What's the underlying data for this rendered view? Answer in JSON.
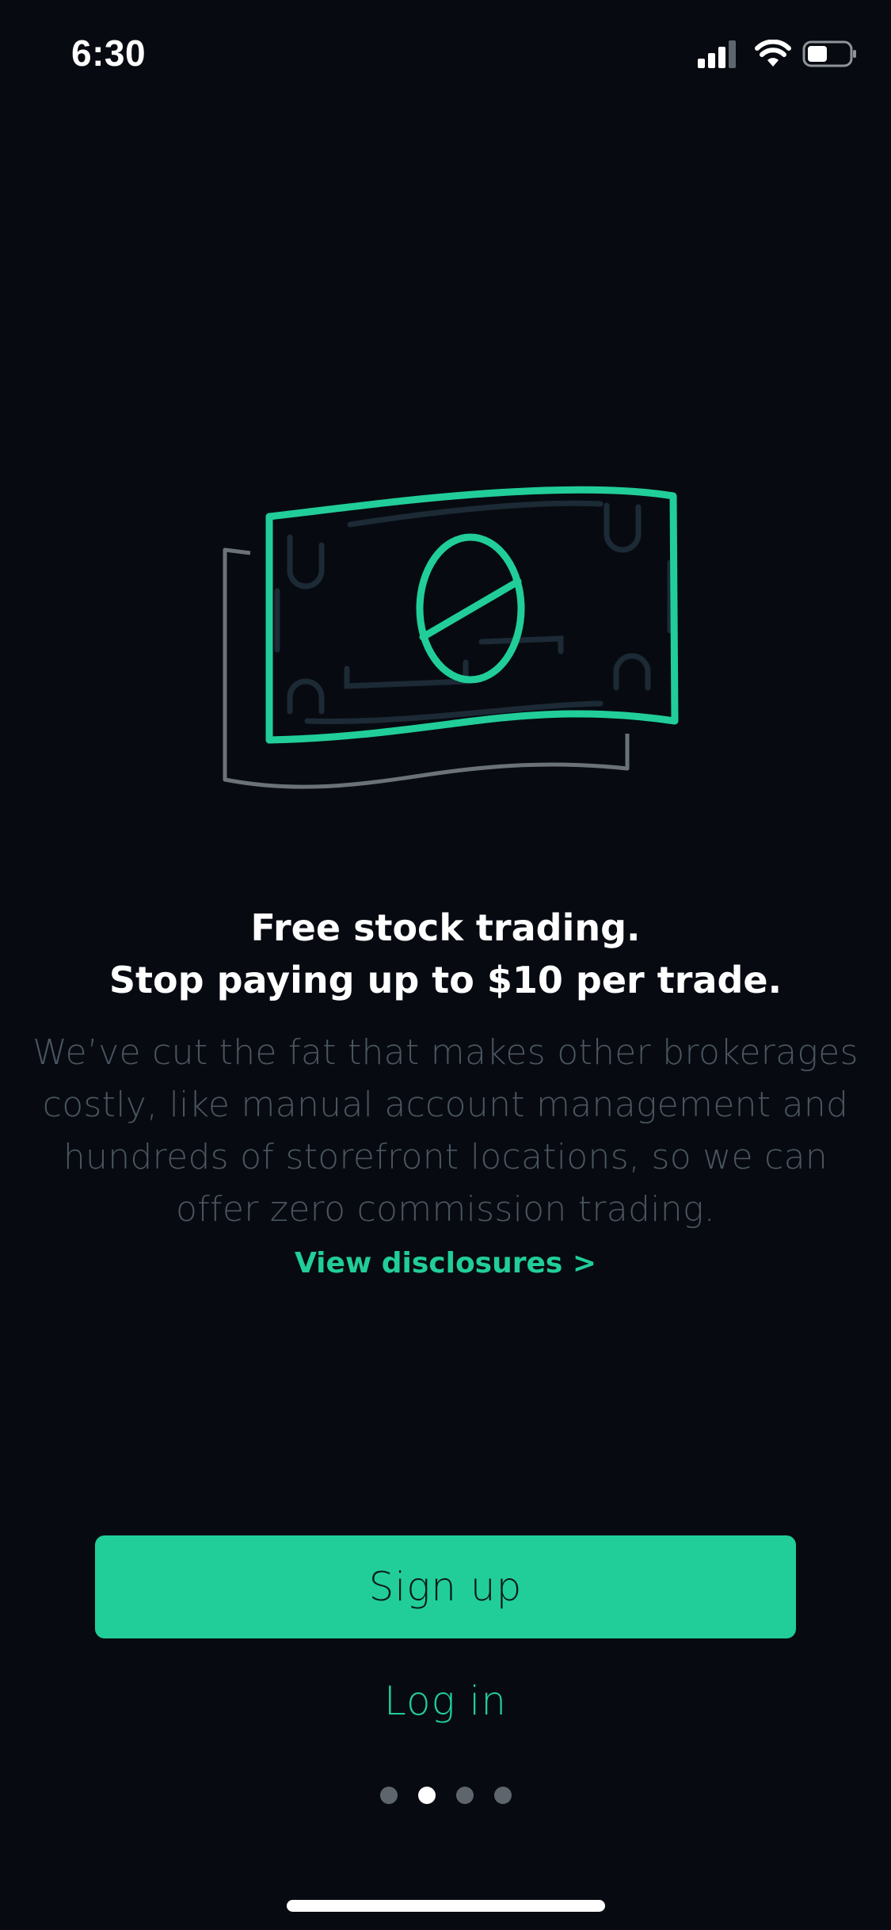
{
  "status_bar": {
    "time": "6:30",
    "icons": [
      "cellular-signal-icon",
      "wifi-icon",
      "battery-icon"
    ]
  },
  "illustration": {
    "icon": "dollar-bill-icon"
  },
  "onboarding": {
    "headline_lines": [
      "Free stock trading.",
      "Stop paying up to $10 per trade."
    ],
    "body_lines": [
      "We’ve cut the fat that makes other brokerages",
      "costly, like manual account management and",
      "hundreds of storefront locations, so we can",
      "offer zero commission trading."
    ],
    "disclosures_link": "View disclosures >"
  },
  "actions": {
    "signup_label": "Sign up",
    "login_label": "Log in"
  },
  "pagination": {
    "total_pages": 4,
    "current_page": 2
  },
  "colors": {
    "background": "#070b11",
    "accent": "#21ce99",
    "body_text": "#4b5560",
    "dot_inactive": "#5e656c",
    "dot_active": "#ffffff"
  }
}
